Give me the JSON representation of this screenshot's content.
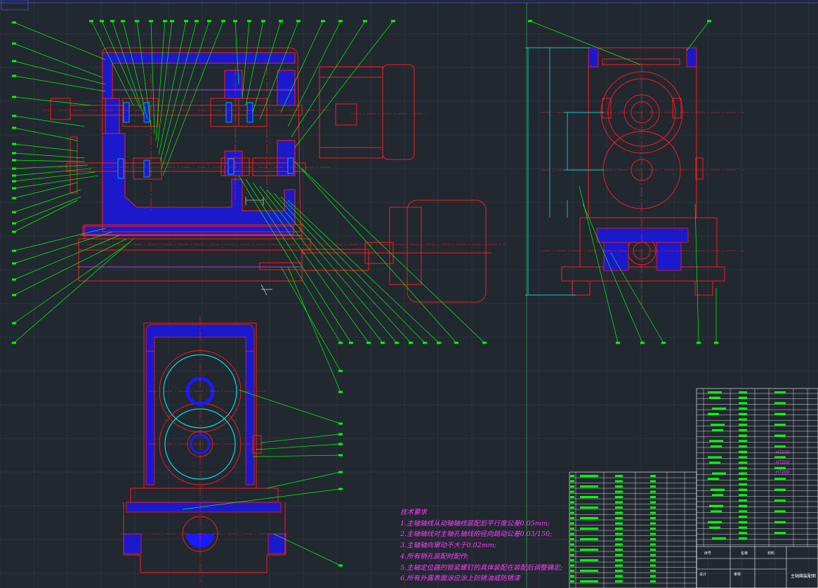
{
  "drawing": {
    "title": "主轴箱装配图"
  },
  "technical_requirements": {
    "heading": "技术要求",
    "items": [
      "1.主轴轴线从动轴轴线装配后平行度公差0.05mm;",
      "2.主轴轴线对主轴孔轴线的径向跳动公差0.03/150;",
      "3.主轴轴向窜动不大于0.02mm;",
      "4.所有销孔装配时配作;",
      "5.主轴定位器的锁紧螺钉的具体装配在装配后调整确定;",
      "6.所有外露表面涂应涂上防锈油或防锈漆"
    ]
  },
  "parts_list_materials": [
    "HT200",
    "HT200",
    "HT200"
  ],
  "title_block": {
    "col_index": "序号",
    "col_name": "名称",
    "col_material": "材料",
    "designer": "设计",
    "checker": "审核"
  },
  "colors": {
    "background": "#212830",
    "outline": "#ff1a1a",
    "section_fill": "#1a1acc",
    "leader": "#00ff00",
    "dimension": "#00ffff",
    "center_line": "#ff2222",
    "notes": "#ff3cff",
    "grid": "#2c3540"
  }
}
